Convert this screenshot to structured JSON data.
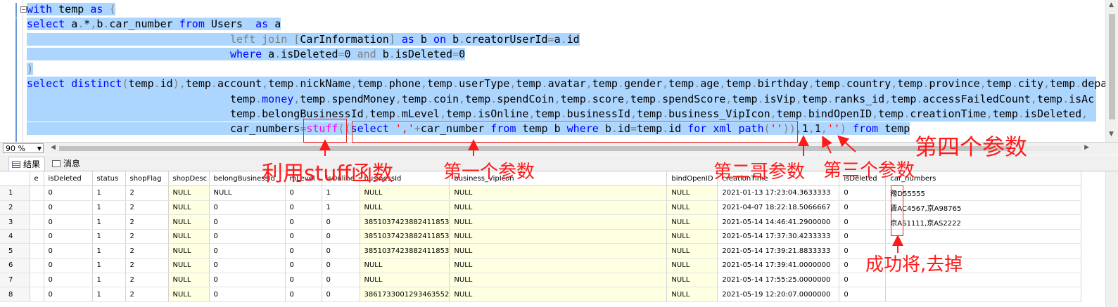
{
  "editor": {
    "lines": [
      [
        [
          "kw",
          "with"
        ],
        [
          "tx",
          " temp "
        ],
        [
          "kw",
          "as"
        ],
        [
          "tx",
          " "
        ],
        [
          "gr",
          "("
        ]
      ],
      [
        [
          "kw",
          "select"
        ],
        [
          "tx",
          " a"
        ],
        [
          "gr",
          "."
        ],
        [
          "tx",
          "*"
        ],
        [
          "gr",
          ","
        ],
        [
          "tx",
          "b"
        ],
        [
          "gr",
          "."
        ],
        [
          "tx",
          "car_number "
        ],
        [
          "kw",
          "from"
        ],
        [
          "tx",
          " Users  "
        ],
        [
          "kw",
          "as"
        ],
        [
          "tx",
          " a"
        ]
      ],
      [
        [
          "tx",
          "                                "
        ],
        [
          "gr",
          "left join"
        ],
        [
          "tx",
          " "
        ],
        [
          "gr",
          "["
        ],
        [
          "tx",
          "CarInformation"
        ],
        [
          "gr",
          "]"
        ],
        [
          "tx",
          " "
        ],
        [
          "kw",
          "as"
        ],
        [
          "tx",
          " b "
        ],
        [
          "kw",
          "on"
        ],
        [
          "tx",
          " b"
        ],
        [
          "gr",
          "."
        ],
        [
          "tx",
          "creatorUserId"
        ],
        [
          "gr",
          "="
        ],
        [
          "tx",
          "a"
        ],
        [
          "gr",
          "."
        ],
        [
          "tx",
          "id"
        ]
      ],
      [
        [
          "tx",
          "                                "
        ],
        [
          "kw",
          "where"
        ],
        [
          "tx",
          " a"
        ],
        [
          "gr",
          "."
        ],
        [
          "tx",
          "isDeleted"
        ],
        [
          "gr",
          "="
        ],
        [
          "tx",
          "0 "
        ],
        [
          "gr",
          "and"
        ],
        [
          "tx",
          " b"
        ],
        [
          "gr",
          "."
        ],
        [
          "tx",
          "isDeleted"
        ],
        [
          "gr",
          "="
        ],
        [
          "tx",
          "0"
        ]
      ],
      [
        [
          "gr",
          ")"
        ]
      ],
      [
        [
          "kw",
          "select"
        ],
        [
          "tx",
          " "
        ],
        [
          "kw",
          "distinct"
        ],
        [
          "gr",
          "("
        ],
        [
          "tx",
          "temp"
        ],
        [
          "gr",
          "."
        ],
        [
          "tx",
          "id"
        ],
        [
          "gr",
          ")"
        ],
        [
          "gr",
          ","
        ],
        [
          "tx",
          "temp"
        ],
        [
          "gr",
          "."
        ],
        [
          "tx",
          "account"
        ],
        [
          "gr",
          ","
        ],
        [
          "tx",
          "temp"
        ],
        [
          "gr",
          "."
        ],
        [
          "tx",
          "nickName"
        ],
        [
          "gr",
          ","
        ],
        [
          "tx",
          "temp"
        ],
        [
          "gr",
          "."
        ],
        [
          "tx",
          "phone"
        ],
        [
          "gr",
          ","
        ],
        [
          "tx",
          "temp"
        ],
        [
          "gr",
          "."
        ],
        [
          "tx",
          "userType"
        ],
        [
          "gr",
          ","
        ],
        [
          "tx",
          "temp"
        ],
        [
          "gr",
          "."
        ],
        [
          "tx",
          "avatar"
        ],
        [
          "gr",
          ","
        ],
        [
          "tx",
          "temp"
        ],
        [
          "gr",
          "."
        ],
        [
          "tx",
          "gender"
        ],
        [
          "gr",
          ","
        ],
        [
          "tx",
          "temp"
        ],
        [
          "gr",
          "."
        ],
        [
          "tx",
          "age"
        ],
        [
          "gr",
          ","
        ],
        [
          "tx",
          "temp"
        ],
        [
          "gr",
          "."
        ],
        [
          "tx",
          "birthday"
        ],
        [
          "gr",
          ","
        ],
        [
          "tx",
          "temp"
        ],
        [
          "gr",
          "."
        ],
        [
          "tx",
          "country"
        ],
        [
          "gr",
          ","
        ],
        [
          "tx",
          "temp"
        ],
        [
          "gr",
          "."
        ],
        [
          "tx",
          "province"
        ],
        [
          "gr",
          ","
        ],
        [
          "tx",
          "temp"
        ],
        [
          "gr",
          "."
        ],
        [
          "tx",
          "city"
        ],
        [
          "gr",
          ","
        ],
        [
          "tx",
          "temp"
        ],
        [
          "gr",
          "."
        ],
        [
          "tx",
          "depa"
        ]
      ],
      [
        [
          "tx",
          "                                temp"
        ],
        [
          "gr",
          "."
        ],
        [
          "kw",
          "money"
        ],
        [
          "gr",
          ","
        ],
        [
          "tx",
          "temp"
        ],
        [
          "gr",
          "."
        ],
        [
          "tx",
          "spendMoney"
        ],
        [
          "gr",
          ","
        ],
        [
          "tx",
          "temp"
        ],
        [
          "gr",
          "."
        ],
        [
          "tx",
          "coin"
        ],
        [
          "gr",
          ","
        ],
        [
          "tx",
          "temp"
        ],
        [
          "gr",
          "."
        ],
        [
          "tx",
          "spendCoin"
        ],
        [
          "gr",
          ","
        ],
        [
          "tx",
          "temp"
        ],
        [
          "gr",
          "."
        ],
        [
          "tx",
          "score"
        ],
        [
          "gr",
          ","
        ],
        [
          "tx",
          "temp"
        ],
        [
          "gr",
          "."
        ],
        [
          "tx",
          "spendScore"
        ],
        [
          "gr",
          ","
        ],
        [
          "tx",
          "temp"
        ],
        [
          "gr",
          "."
        ],
        [
          "tx",
          "isVip"
        ],
        [
          "gr",
          ","
        ],
        [
          "tx",
          "temp"
        ],
        [
          "gr",
          "."
        ],
        [
          "tx",
          "ranks_id"
        ],
        [
          "gr",
          ","
        ],
        [
          "tx",
          "temp"
        ],
        [
          "gr",
          "."
        ],
        [
          "tx",
          "accessFailedCount"
        ],
        [
          "gr",
          ","
        ],
        [
          "tx",
          "temp"
        ],
        [
          "gr",
          "."
        ],
        [
          "tx",
          "isAc"
        ]
      ],
      [
        [
          "tx",
          "                                temp"
        ],
        [
          "gr",
          "."
        ],
        [
          "tx",
          "belongBusinessId"
        ],
        [
          "gr",
          ","
        ],
        [
          "tx",
          "temp"
        ],
        [
          "gr",
          "."
        ],
        [
          "tx",
          "mLevel"
        ],
        [
          "gr",
          ","
        ],
        [
          "tx",
          "temp"
        ],
        [
          "gr",
          "."
        ],
        [
          "tx",
          "isOnline"
        ],
        [
          "gr",
          ","
        ],
        [
          "tx",
          "temp"
        ],
        [
          "gr",
          "."
        ],
        [
          "tx",
          "businessId"
        ],
        [
          "gr",
          ","
        ],
        [
          "tx",
          "temp"
        ],
        [
          "gr",
          "."
        ],
        [
          "tx",
          "business_VipIcon"
        ],
        [
          "gr",
          ","
        ],
        [
          "tx",
          "temp"
        ],
        [
          "gr",
          "."
        ],
        [
          "tx",
          "bindOpenID"
        ],
        [
          "gr",
          ","
        ],
        [
          "tx",
          "temp"
        ],
        [
          "gr",
          "."
        ],
        [
          "tx",
          "creationTime"
        ],
        [
          "gr",
          ","
        ],
        [
          "tx",
          "temp"
        ],
        [
          "gr",
          "."
        ],
        [
          "tx",
          "isDeleted"
        ],
        [
          "gr",
          ","
        ]
      ],
      [
        [
          "tx",
          "                                car_numbers"
        ],
        [
          "gr",
          "="
        ],
        [
          "fn",
          "stuff"
        ],
        [
          "gr",
          "(("
        ],
        [
          "kw",
          "select"
        ],
        [
          "tx",
          " "
        ],
        [
          "st",
          "','"
        ],
        [
          "gr",
          "+"
        ],
        [
          "tx",
          "car_number "
        ],
        [
          "kw",
          "from"
        ],
        [
          "tx",
          " temp b "
        ],
        [
          "kw",
          "where"
        ],
        [
          "tx",
          " b"
        ],
        [
          "gr",
          "."
        ],
        [
          "tx",
          "id"
        ],
        [
          "gr",
          "="
        ],
        [
          "tx",
          "temp"
        ],
        [
          "gr",
          "."
        ],
        [
          "tx",
          "id "
        ],
        [
          "kw",
          "for"
        ],
        [
          "tx",
          " "
        ],
        [
          "kw",
          "xml"
        ],
        [
          "tx",
          " "
        ],
        [
          "kw",
          "path"
        ],
        [
          "gr",
          "("
        ],
        [
          "st",
          "''"
        ],
        [
          "gr",
          "))"
        ],
        [
          "gr",
          ","
        ],
        [
          "tx",
          "1"
        ],
        [
          "gr",
          ","
        ],
        [
          "tx",
          "1"
        ],
        [
          "gr",
          ","
        ],
        [
          "st",
          "''"
        ],
        [
          "gr",
          ")"
        ],
        [
          "tx",
          " "
        ],
        [
          "kw",
          "from"
        ],
        [
          "tx",
          " temp"
        ]
      ]
    ]
  },
  "statusbar": {
    "zoom": "90 %"
  },
  "tabs": [
    {
      "label": "结果",
      "active": true
    },
    {
      "label": "消息",
      "active": false
    }
  ],
  "grid": {
    "columns": [
      "e",
      "isDeleted",
      "status",
      "shopFlag",
      "shopDesc",
      "belongBusinessId",
      "mLevel",
      "isOnline",
      "businessId",
      "business_VipIcon",
      "bindOpenID",
      "creationTime",
      "isDeleted",
      "car_numbers"
    ],
    "rows": [
      [
        "1",
        "",
        "0",
        "1",
        "2",
        "NULL",
        "NULL",
        "0",
        "1",
        "NULL",
        "NULL",
        "NULL",
        "2021-01-13 17:23:04.3633333",
        "0",
        "豫D55555"
      ],
      [
        "2",
        "",
        "0",
        "1",
        "2",
        "NULL",
        "0",
        "0",
        "1",
        "NULL",
        "NULL",
        "NULL",
        "2021-04-07 18:22:18.5066667",
        "0",
        "晋AC4567,京A98765"
      ],
      [
        "3",
        "",
        "0",
        "1",
        "2",
        "NULL",
        "0",
        "0",
        "0",
        "3851037423882411853",
        "NULL",
        "NULL",
        "2021-05-14 14:46:41.2900000",
        "0",
        "京AS1111,京AS2222"
      ],
      [
        "4",
        "",
        "0",
        "1",
        "2",
        "NULL",
        "0",
        "0",
        "0",
        "3851037423882411853",
        "NULL",
        "NULL",
        "2021-05-14 17:37:30.4233333",
        "0",
        ""
      ],
      [
        "5",
        "",
        "0",
        "1",
        "2",
        "NULL",
        "0",
        "0",
        "0",
        "3851037423882411853",
        "NULL",
        "NULL",
        "2021-05-14 17:39:21.8833333",
        "0",
        ""
      ],
      [
        "6",
        "",
        "0",
        "1",
        "2",
        "NULL",
        "0",
        "0",
        "0",
        "NULL",
        "NULL",
        "NULL",
        "2021-05-14 17:39:41.0000000",
        "0",
        ""
      ],
      [
        "7",
        "",
        "0",
        "1",
        "2",
        "NULL",
        "0",
        "0",
        "0",
        "NULL",
        "NULL",
        "NULL",
        "2021-05-14 17:55:25.0000000",
        "0",
        ""
      ],
      [
        "8",
        "",
        "0",
        "1",
        "2",
        "NULL",
        "0",
        "0",
        "0",
        "3861733001293463552",
        "NULL",
        "NULL",
        "2021-05-19 12:20:07.0000000",
        "0",
        ""
      ]
    ]
  },
  "annotations": {
    "stuff_func": "利用stuff函数",
    "param1": "第一个参数",
    "param2": "第二哥参数",
    "param3": "第三个参数",
    "param4": "第四个参数",
    "result": "成功将,去掉",
    "color": "#ff1a1a"
  }
}
